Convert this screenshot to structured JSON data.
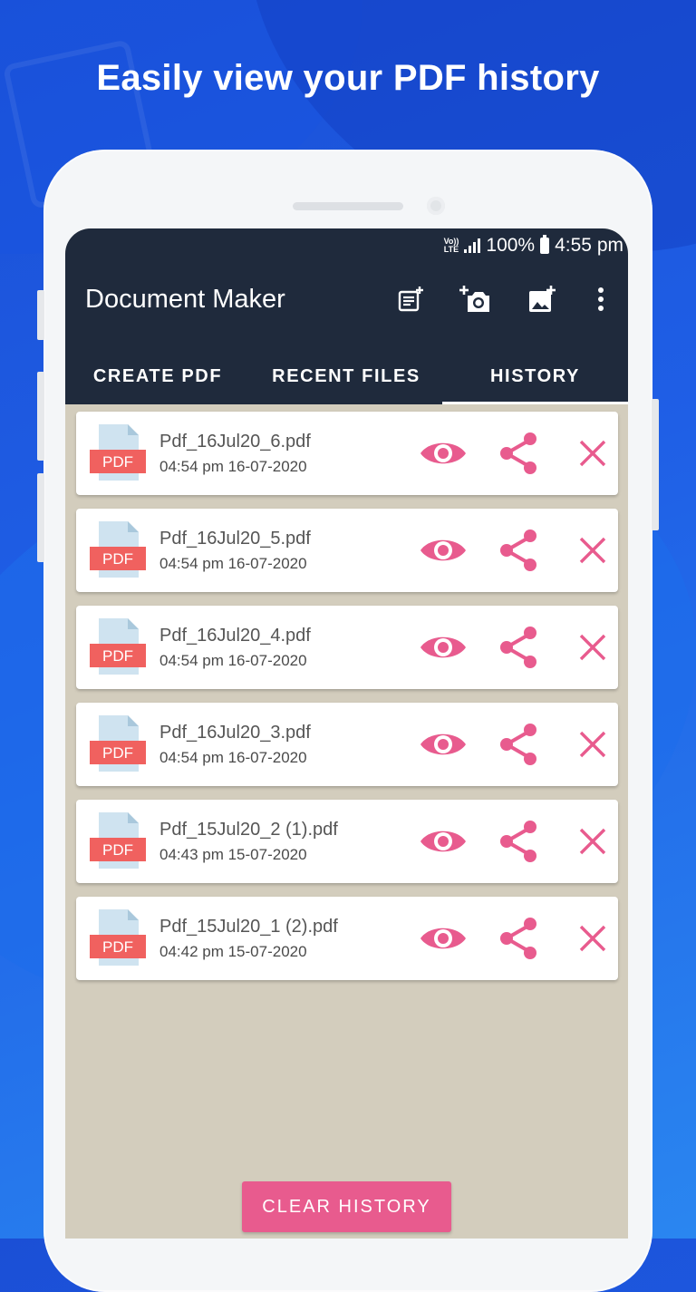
{
  "headline": "Easily view your PDF history",
  "status_bar": {
    "network_label_top": "Vo))",
    "network_label_bottom": "LTE",
    "battery": "100%",
    "time": "4:55 pm"
  },
  "app": {
    "title": "Document Maker",
    "toolbar_icons": [
      "add-document-icon",
      "add-camera-icon",
      "add-image-icon",
      "more-vert-icon"
    ]
  },
  "tabs": [
    {
      "label": "CREATE PDF",
      "active": false
    },
    {
      "label": "RECENT FILES",
      "active": false
    },
    {
      "label": "HISTORY",
      "active": true
    }
  ],
  "history": [
    {
      "name": "Pdf_16Jul20_6.pdf",
      "date": "04:54 pm 16-07-2020",
      "badge": "PDF"
    },
    {
      "name": "Pdf_16Jul20_5.pdf",
      "date": "04:54 pm 16-07-2020",
      "badge": "PDF"
    },
    {
      "name": "Pdf_16Jul20_4.pdf",
      "date": "04:54 pm 16-07-2020",
      "badge": "PDF"
    },
    {
      "name": "Pdf_16Jul20_3.pdf",
      "date": "04:54 pm 16-07-2020",
      "badge": "PDF"
    },
    {
      "name": "Pdf_15Jul20_2 (1).pdf",
      "date": "04:43 pm 15-07-2020",
      "badge": "PDF"
    },
    {
      "name": "Pdf_15Jul20_1 (2).pdf",
      "date": "04:42 pm 15-07-2020",
      "badge": "PDF"
    }
  ],
  "clear_history_label": "CLEAR HISTORY",
  "colors": {
    "background": "#1f5fe6",
    "appbar": "#1f2a3c",
    "accent_pink": "#e85b8e",
    "list_background": "#d3cdbd",
    "pdf_red": "#f0615f",
    "pdf_page": "#cfe3f0"
  }
}
